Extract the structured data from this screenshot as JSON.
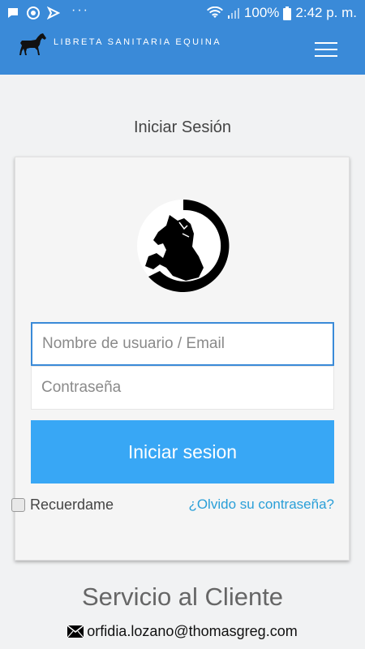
{
  "status_bar": {
    "dots": "···",
    "battery_percent": "100%",
    "time": "2:42 p. m."
  },
  "app_bar": {
    "title": "LIBRETA SANITARIA EQUINA",
    "logo_icon": "horse-icon",
    "menu_icon": "hamburger-menu-icon"
  },
  "page_title": "Iniciar Sesión",
  "login": {
    "username_placeholder": "Nombre de usuario / Email",
    "password_placeholder": "Contraseña",
    "submit_label": "Iniciar sesion",
    "remember_label": "Recuerdame",
    "forgot_link": "¿Olvido su contraseña?"
  },
  "footer": {
    "service_title": "Servicio al Cliente",
    "email": "orfidia.lozano@thomasgreg.com",
    "email_icon": "envelope-icon"
  },
  "colors": {
    "primary": "#3a8ad8",
    "button": "#38a7f5",
    "link": "#2a9fd8",
    "background": "#f1f2f3"
  }
}
